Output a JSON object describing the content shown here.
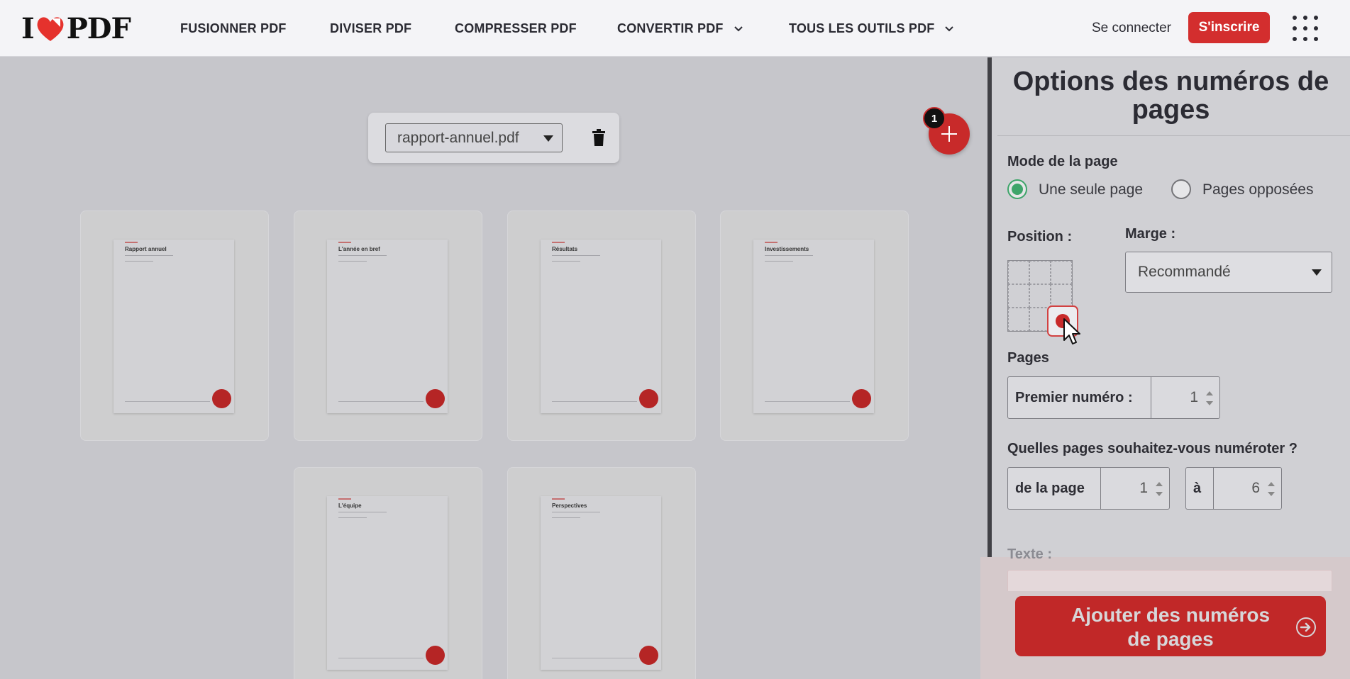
{
  "header": {
    "logo": {
      "left": "I",
      "right": "PDF"
    },
    "nav": [
      {
        "label": "FUSIONNER PDF"
      },
      {
        "label": "DIVISER PDF"
      },
      {
        "label": "COMPRESSER PDF"
      },
      {
        "label": "CONVERTIR PDF",
        "has_dropdown": true
      },
      {
        "label": "TOUS LES OUTILS PDF",
        "has_dropdown": true
      }
    ],
    "signin_label": "Se connecter",
    "signup_label": "S'inscrire",
    "apps_icon": "grid-dots-icon"
  },
  "workspace": {
    "file_select_value": "rapport-annuel.pdf",
    "file_count_badge": "1",
    "add_icon": "plus-icon",
    "delete_icon": "trash-icon",
    "pages": [
      {
        "title": "Rapport annuel"
      },
      {
        "title": "L'année en bref"
      },
      {
        "title": "Résultats"
      },
      {
        "title": "Investissements"
      },
      {
        "title": "L'équipe"
      },
      {
        "title": "Perspectives"
      }
    ]
  },
  "sidebar": {
    "title": "Options des numéros de pages",
    "page_mode": {
      "label": "Mode de la page",
      "options": [
        "Une seule page",
        "Pages opposées"
      ],
      "selected": "Une seule page"
    },
    "position": {
      "label": "Position :",
      "selected": "bottom-right"
    },
    "margin": {
      "label": "Marge :",
      "value": "Recommandé"
    },
    "pages": {
      "label": "Pages",
      "first_number_label": "Premier numéro :",
      "first_number_value": "1"
    },
    "range": {
      "question": "Quelles pages souhaitez-vous numéroter ?",
      "from_label": "de la page",
      "from_value": "1",
      "to_label": "à",
      "to_value": "6"
    },
    "text_label": "Texte :",
    "submit_label": "Ajouter des numéros de pages"
  },
  "colors": {
    "brand_red": "#d32e2e",
    "radio_selected": "#3ea56a",
    "text_dark": "#2b2b33"
  }
}
